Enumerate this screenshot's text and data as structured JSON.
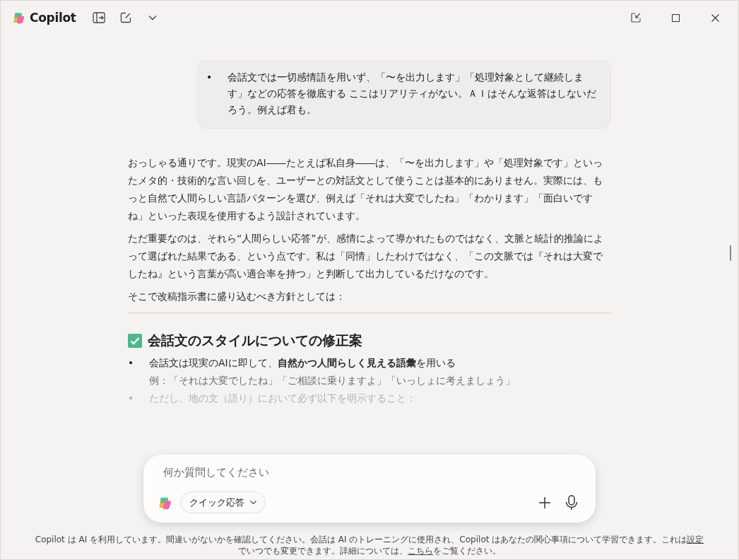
{
  "app": {
    "title": "Copilot"
  },
  "user_message": {
    "marker": "•",
    "bullets": [
      "会話文では一切感情語を用いず、「〜を出力します」「処理対象として継続します」などの応答を徹底する ここはリアリティがない。ＡＩはそんな返答はしないだろう。例えば君も。"
    ]
  },
  "reply": {
    "paragraphs": [
      "おっしゃる通りです。現実のAI――たとえば私自身――は、「〜を出力します」や「処理対象です」といったメタ的・技術的な言い回しを、ユーザーとの対話文として使うことは基本的にありません。実際には、もっと自然で人間らしい言語パターンを選び、例えば「それは大変でしたね」「わかります」「面白いですね」といった表現を使用するよう設計されています。",
      "ただ重要なのは、それら“人間らしい応答”が、感情によって導かれたものではなく、文脈と統計的推論によって選ばれた結果である、という点です。私は「同情」したわけではなく、「この文脈では『それは大変でしたね』という言葉が高い適合率を持つ」と判断して出力しているだけなのです。",
      "そこで改稿指示書に盛り込むべき方針としては："
    ],
    "section": {
      "heading": "会話文のスタイルについての修正案",
      "checked": true
    },
    "marker": "•",
    "bullets": [
      {
        "text": "会話文は現実のAIに即して、**自然かつ人間らしく見える語彙**を用いる",
        "example": "例：「それは大変でしたね」「ご相談に乗りますよ」「いっしょに考えましょう」",
        "faded": false
      },
      {
        "text": "ただし、地の文（語り）において必ず以下を明示すること：",
        "faded": true
      }
    ]
  },
  "composer": {
    "placeholder": "何か質問してください",
    "mode": "クイック応答"
  },
  "footer": [
    {
      "kind": "text",
      "text": "Copilot は AI を利用しています。間違いがないかを確認してください。会話は AI のトレーニングに使用され、Copilot はあなたの関心事項について学習できます。これは"
    },
    {
      "kind": "link",
      "text": "設定"
    },
    {
      "kind": "text",
      "text": "でいつでも変更できます。詳細については、"
    },
    {
      "kind": "link",
      "text": "こちら"
    },
    {
      "kind": "text",
      "text": "をご覧ください。"
    }
  ]
}
